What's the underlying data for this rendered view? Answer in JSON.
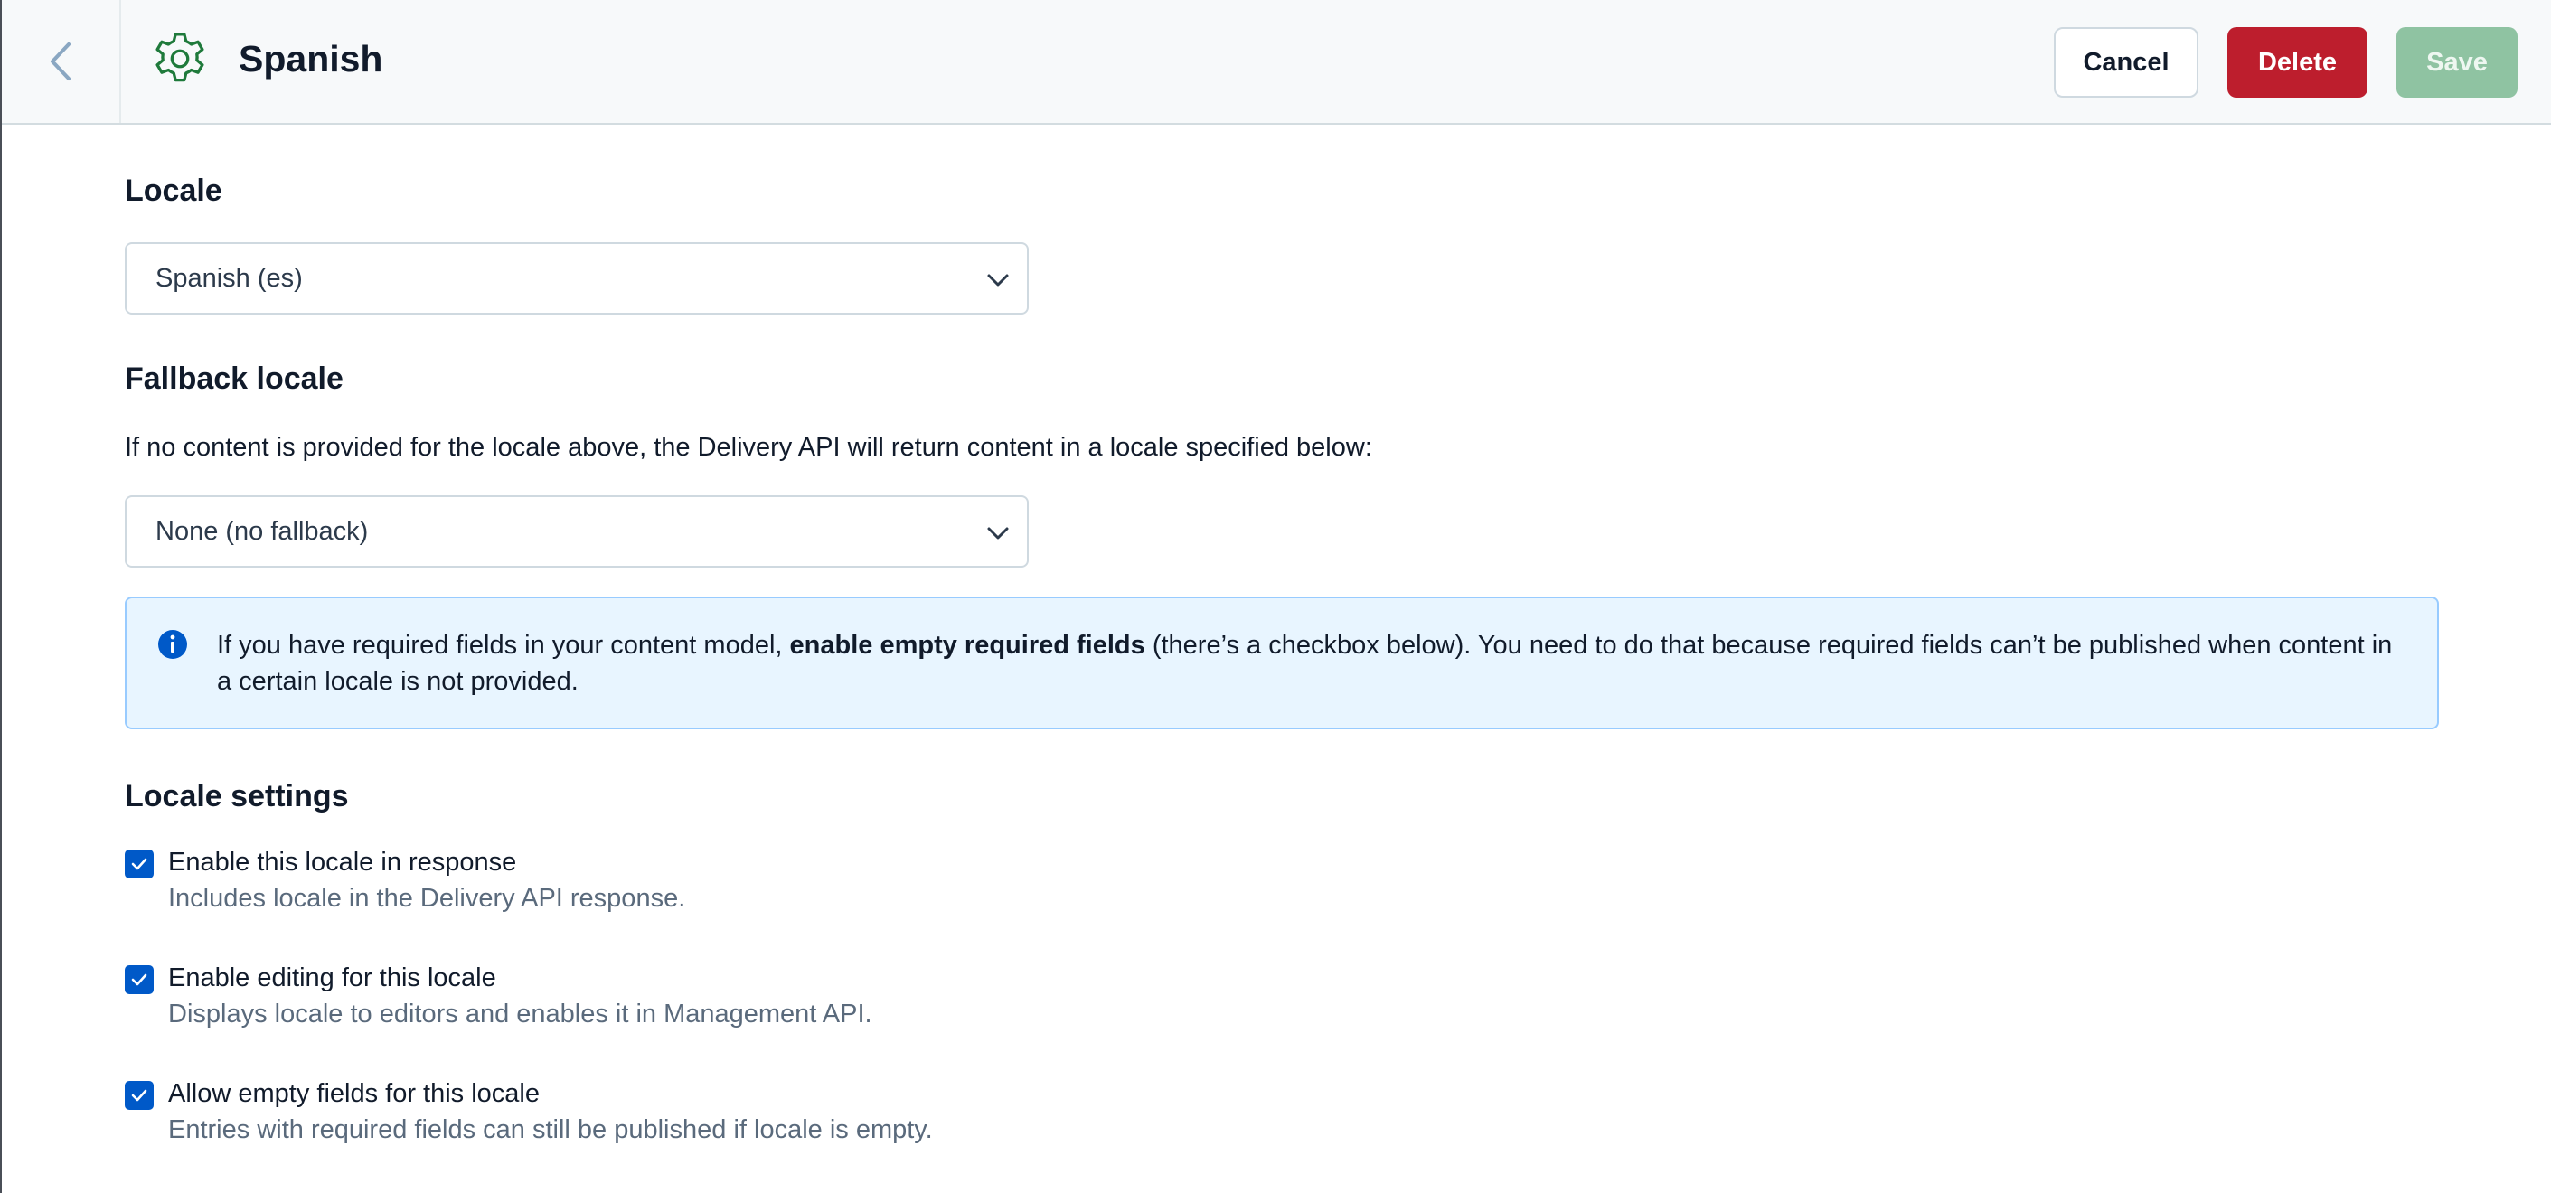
{
  "header": {
    "title": "Spanish",
    "cancel_label": "Cancel",
    "delete_label": "Delete",
    "save_label": "Save"
  },
  "locale": {
    "heading": "Locale",
    "selected": "Spanish (es)"
  },
  "fallback": {
    "heading": "Fallback locale",
    "description": "If no content is provided for the locale above, the Delivery API will return content in a locale specified below:",
    "selected": "None (no fallback)"
  },
  "note": {
    "text_before": "If you have required fields in your content model, ",
    "text_bold": "enable empty required fields",
    "text_after": " (there’s a checkbox below). You need to do that because required fields can’t be published when content in a certain locale is not provided."
  },
  "settings": {
    "heading": "Locale settings",
    "items": [
      {
        "label": "Enable this locale in response",
        "help": "Includes locale in the Delivery API response.",
        "checked": true
      },
      {
        "label": "Enable editing for this locale",
        "help": "Displays locale to editors and enables it in Management API.",
        "checked": true
      },
      {
        "label": "Allow empty fields for this locale",
        "help": "Entries with required fields can still be published if locale is empty.",
        "checked": true
      }
    ]
  },
  "icons": {
    "back": "chevron-left-icon",
    "settings": "gear-icon",
    "dropdown": "chevron-down-icon",
    "info": "info-icon",
    "check": "check-icon"
  },
  "colors": {
    "delete": "#bd1e2d",
    "save": "#8fc3a2",
    "checkbox": "#0059c8",
    "gear": "#1f7a3b",
    "note_bg": "#e8f5ff",
    "note_border": "#98cbff"
  }
}
